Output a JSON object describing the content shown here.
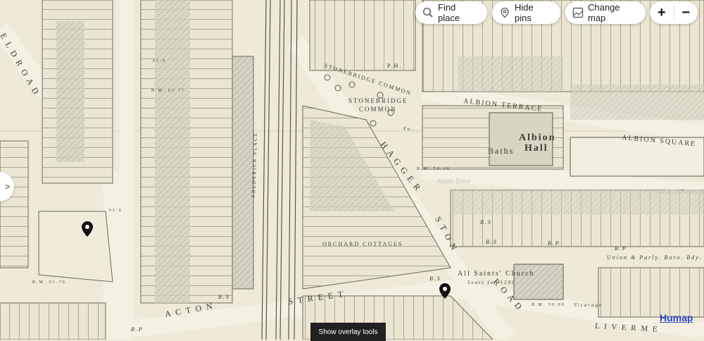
{
  "toolbar": {
    "find_place": "Find place",
    "hide_pins": "Hide pins",
    "change_map": "Change map",
    "zoom_in": "+",
    "zoom_out": "−"
  },
  "side_tab": ">",
  "overlay_tools": "Show overlay tools",
  "brand": "Humap",
  "map_labels": {
    "field_road": "E L D   R O A D",
    "stonebridge_common_road": "STONEBRIDGE COMMON",
    "stonebridge_common_1": "STONEBRIDGE",
    "stonebridge_common_2": "COMMON",
    "albion_terrace": "ALBION TERRACE",
    "albion_square": "ALBION SQUARE",
    "albion_square_faint": "Albion Square",
    "albion_hall_1": "Albion",
    "albion_hall_2": "Hall",
    "baths": "Baths",
    "haggerston_1": "H A G G E R",
    "haggerston_2": "S T O N",
    "haggerston_3": "R O A D",
    "frederick_place": "FREDERICK PLACE",
    "orchard_cottages": "ORCHARD COTTAGES",
    "acton_street_1": "A C T O N",
    "acton_street_2": "S T R E E T",
    "all_saints": "All Saints' Church",
    "seats": "Seats for 1200",
    "union_bdy": "Union & Parly. Boro. Bdy.",
    "vicarage": "Vicarage",
    "livermere": "L I V E R M E",
    "albion_drive": "Albion Drive",
    "ph": "P.H.",
    "fo": "Fo.",
    "bm1": "B.M. 50·46",
    "bm2": "B.M. 61·76",
    "bm3": "B.M. 50·99",
    "bm4": "B.M. 63·77",
    "bs": "B.S",
    "bp": "B.P",
    "num1": "61·6",
    "num2": "61·9"
  },
  "colors": {
    "paper": "#efead8",
    "ink": "#3d3a33",
    "brand": "#2b3fc9"
  }
}
